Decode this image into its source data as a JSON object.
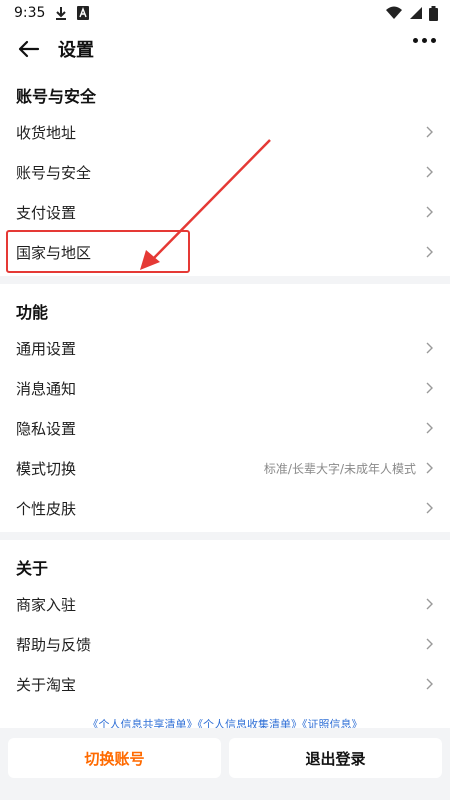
{
  "status_bar": {
    "time": "9:35",
    "icons_left": [
      "download-icon",
      "keyboard-a-icon"
    ],
    "icons_right": [
      "wifi-icon",
      "signal-icon",
      "battery-icon"
    ]
  },
  "header": {
    "title": "设置",
    "back_icon": "arrow-left-icon",
    "more_icon": "more-horizontal-icon"
  },
  "sections": {
    "account": {
      "title": "账号与安全",
      "items": [
        {
          "label": "收货地址"
        },
        {
          "label": "账号与安全"
        },
        {
          "label": "支付设置"
        },
        {
          "label": "国家与地区"
        }
      ]
    },
    "features": {
      "title": "功能",
      "items": [
        {
          "label": "通用设置"
        },
        {
          "label": "消息通知"
        },
        {
          "label": "隐私设置"
        },
        {
          "label": "模式切换",
          "value": "标准/长辈大字/未成年人模式"
        },
        {
          "label": "个性皮肤"
        }
      ]
    },
    "about": {
      "title": "关于",
      "items": [
        {
          "label": "商家入驻"
        },
        {
          "label": "帮助与反馈"
        },
        {
          "label": "关于淘宝"
        }
      ]
    }
  },
  "footer_links": "《个人信息共享清单》《个人信息收集清单》《证照信息》",
  "bottom_buttons": {
    "switch_account": "切换账号",
    "logout": "退出登录"
  },
  "colors": {
    "accent_orange": "#ff6a00",
    "annotation_red": "#e53935",
    "link_blue": "#2f6fd6",
    "divider_gray": "#f3f4f6"
  }
}
